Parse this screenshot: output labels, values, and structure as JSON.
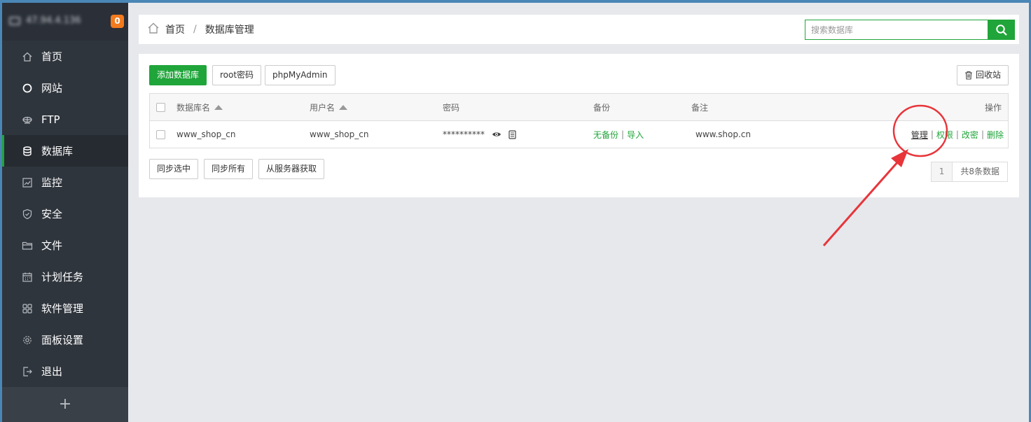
{
  "sidebar": {
    "host": "47.94.4.136",
    "badge": "0",
    "items": [
      {
        "label": "首页",
        "icon": "home-icon"
      },
      {
        "label": "网站",
        "icon": "globe-icon"
      },
      {
        "label": "FTP",
        "icon": "ftp-icon"
      },
      {
        "label": "数据库",
        "icon": "database-icon"
      },
      {
        "label": "监控",
        "icon": "monitor-icon"
      },
      {
        "label": "安全",
        "icon": "shield-icon"
      },
      {
        "label": "文件",
        "icon": "folder-icon"
      },
      {
        "label": "计划任务",
        "icon": "calendar-icon"
      },
      {
        "label": "软件管理",
        "icon": "grid-icon"
      },
      {
        "label": "面板设置",
        "icon": "gear-icon"
      },
      {
        "label": "退出",
        "icon": "logout-icon"
      }
    ],
    "add": "+"
  },
  "breadcrumb": {
    "home": "首页",
    "sep": "/",
    "current": "数据库管理"
  },
  "search": {
    "placeholder": "搜索数据库"
  },
  "toolbar": {
    "add_db": "添加数据库",
    "root_pwd": "root密码",
    "phpmyadmin": "phpMyAdmin",
    "recycle": "回收站"
  },
  "table": {
    "headers": {
      "name": "数据库名",
      "user": "用户名",
      "password": "密码",
      "backup": "备份",
      "note": "备注",
      "ops": "操作"
    },
    "rows": [
      {
        "name": "www_shop_cn",
        "user": "www_shop_cn",
        "password": "**********",
        "backup_none": "无备份",
        "backup_import": "导入",
        "note": "www.shop.cn",
        "op_manage": "管理",
        "op_perm": "权限",
        "op_pwd": "改密",
        "op_delete": "删除"
      }
    ],
    "sep": "|"
  },
  "footer": {
    "sync_selected": "同步选中",
    "sync_all": "同步所有",
    "fetch_server": "从服务器获取",
    "page": "1",
    "total": "共8条数据"
  },
  "colors": {
    "accent": "#20a53a",
    "sidebar": "#2f353d",
    "badge": "#f37b1d",
    "annotation": "#e8353a"
  }
}
